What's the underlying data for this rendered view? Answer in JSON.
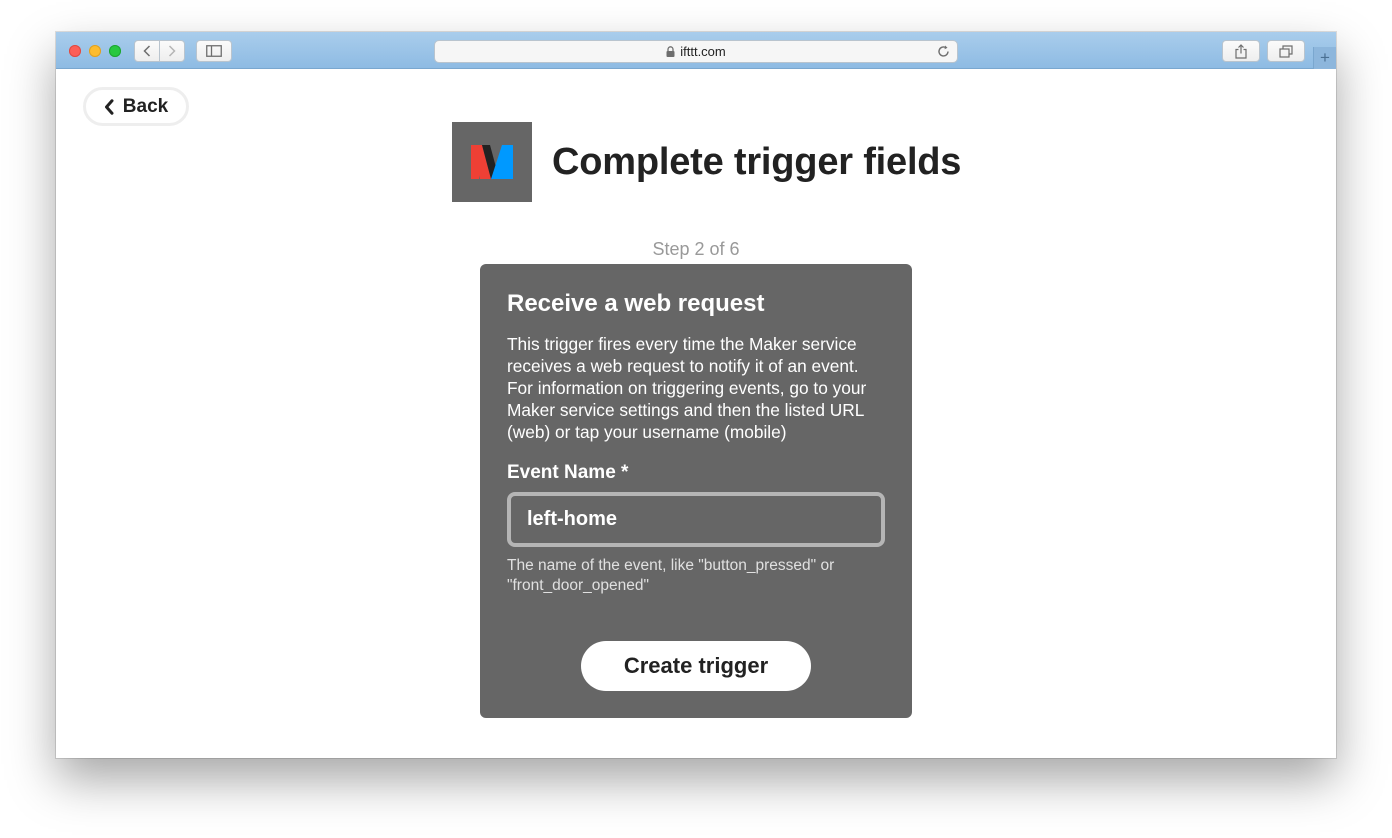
{
  "browser": {
    "url": "ifttt.com"
  },
  "page": {
    "back_label": "Back",
    "title": "Complete trigger fields",
    "step": "Step 2 of 6"
  },
  "trigger": {
    "name": "Receive a web request",
    "description": "This trigger fires every time the Maker service receives a web request to notify it of an event. For information on triggering events, go to your Maker service settings and then the listed URL (web) or tap your username (mobile)",
    "field_label": "Event Name *",
    "field_value": "left-home",
    "field_help": "The name of the event, like \"button_pressed\" or \"front_door_opened\"",
    "submit_label": "Create trigger"
  },
  "colors": {
    "card_bg": "#666666",
    "logo_red": "#ee4035",
    "logo_blue": "#0099ff",
    "logo_dark": "#222222"
  }
}
